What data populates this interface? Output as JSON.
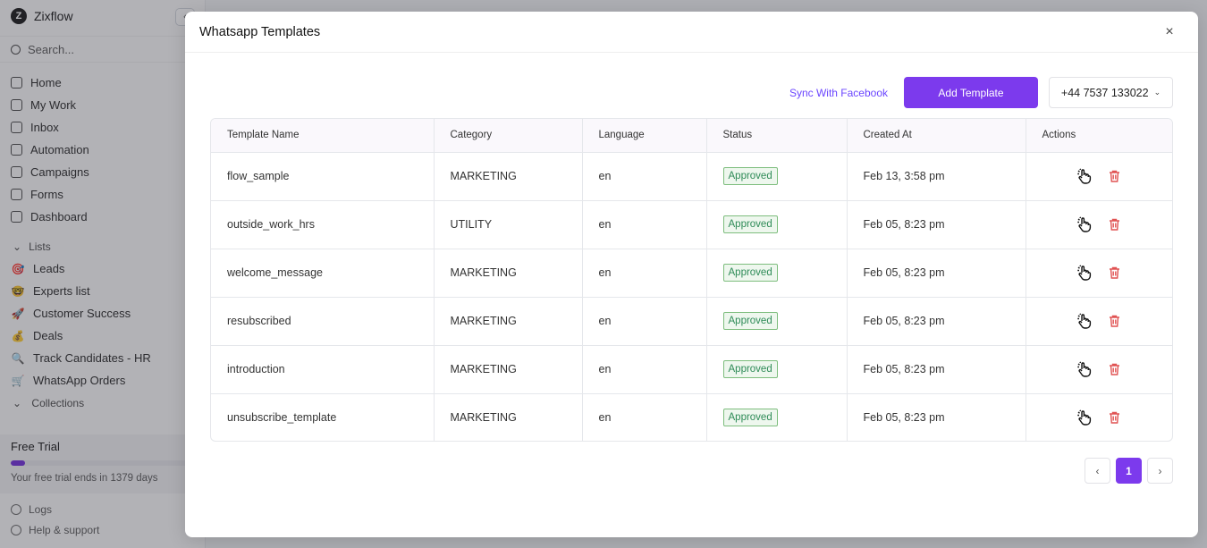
{
  "sidebar": {
    "brand": "Zixflow",
    "brand_logo": "Z",
    "collapse_icon": "‹",
    "search_placeholder": "Search...",
    "nav": [
      {
        "label": "Home",
        "icon": "home-icon"
      },
      {
        "label": "My Work",
        "icon": "checklist-icon"
      },
      {
        "label": "Inbox",
        "icon": "inbox-icon"
      },
      {
        "label": "Automation",
        "icon": "bulb-icon"
      },
      {
        "label": "Campaigns",
        "icon": "megaphone-icon"
      },
      {
        "label": "Forms",
        "icon": "chat-icon"
      },
      {
        "label": "Dashboard",
        "icon": "bar-chart-icon"
      }
    ],
    "lists_label": "Lists",
    "lists": [
      {
        "label": "Leads",
        "emoji": "🎯"
      },
      {
        "label": "Experts list",
        "emoji": "🤓"
      },
      {
        "label": "Customer Success",
        "emoji": "🚀"
      },
      {
        "label": "Deals",
        "emoji": "💰"
      },
      {
        "label": "Track Candidates - HR",
        "emoji": "🔍"
      },
      {
        "label": "WhatsApp Orders",
        "emoji": "🛒"
      }
    ],
    "collections_label": "Collections",
    "trial": {
      "title": "Free Trial",
      "text": "Your free trial ends in 1379 days",
      "progress": 0.08
    },
    "footer": [
      {
        "label": "Logs"
      },
      {
        "label": "Help & support"
      }
    ]
  },
  "modal": {
    "title": "Whatsapp Templates",
    "close": "×",
    "sync_label": "Sync With Facebook",
    "add_label": "Add Template",
    "phone": "+44 7537 133022",
    "columns": [
      "Template Name",
      "Category",
      "Language",
      "Status",
      "Created At",
      "Actions"
    ],
    "rows": [
      {
        "name": "flow_sample",
        "category": "MARKETING",
        "language": "en",
        "status": "Approved",
        "created": "Feb 13, 3:58 pm"
      },
      {
        "name": "outside_work_hrs",
        "category": "UTILITY",
        "language": "en",
        "status": "Approved",
        "created": "Feb 05, 8:23 pm"
      },
      {
        "name": "welcome_message",
        "category": "MARKETING",
        "language": "en",
        "status": "Approved",
        "created": "Feb 05, 8:23 pm"
      },
      {
        "name": "resubscribed",
        "category": "MARKETING",
        "language": "en",
        "status": "Approved",
        "created": "Feb 05, 8:23 pm"
      },
      {
        "name": "introduction",
        "category": "MARKETING",
        "language": "en",
        "status": "Approved",
        "created": "Feb 05, 8:23 pm"
      },
      {
        "name": "unsubscribe_template",
        "category": "MARKETING",
        "language": "en",
        "status": "Approved",
        "created": "Feb 05, 8:23 pm"
      }
    ],
    "pagination": {
      "prev": "‹",
      "current": "1",
      "next": "›"
    }
  },
  "colors": {
    "accent": "#7c3aed",
    "approved": "#2e8b57",
    "delete": "#e05252"
  }
}
